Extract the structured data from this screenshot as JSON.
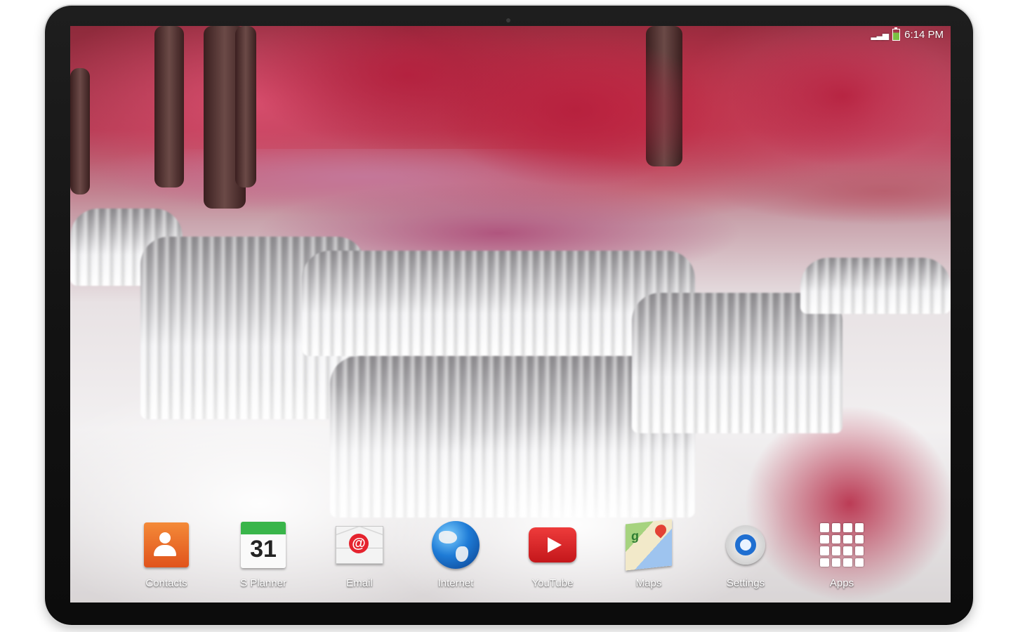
{
  "status_bar": {
    "time": "6:14 PM"
  },
  "dock": {
    "apps": [
      {
        "label": "Contacts",
        "icon": "contacts-icon"
      },
      {
        "label": "S Planner",
        "icon": "calendar-icon",
        "badge_text": "31"
      },
      {
        "label": "Email",
        "icon": "email-icon"
      },
      {
        "label": "Internet",
        "icon": "globe-icon"
      },
      {
        "label": "YouTube",
        "icon": "youtube-icon"
      },
      {
        "label": "Maps",
        "icon": "maps-icon"
      },
      {
        "label": "Settings",
        "icon": "settings-icon"
      },
      {
        "label": "Apps",
        "icon": "apps-grid-icon"
      }
    ]
  },
  "colors": {
    "contacts": "#e0531c",
    "planner_header": "#39b54a",
    "youtube": "#c4171b",
    "settings_ring": "#1f6fd1",
    "foliage": "#c83049"
  }
}
